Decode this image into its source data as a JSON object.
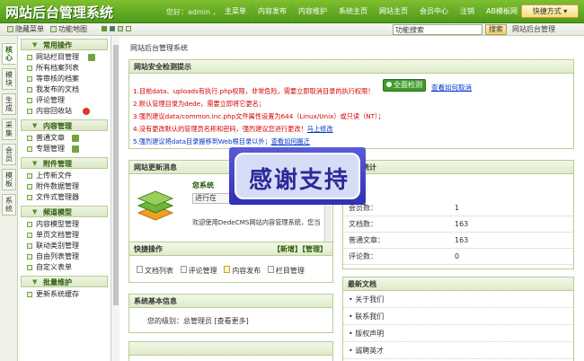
{
  "header": {
    "logo": "网站后台管理系统",
    "greeting": "您好：admin ，",
    "nav": [
      "主菜单",
      "内容发布",
      "内容维护",
      "系统主页",
      "网站主页",
      "会员中心",
      "注销",
      "AB模板网"
    ],
    "quick_button": "快捷方式 ▾"
  },
  "toolbar": {
    "hide_menu": "隐藏菜单",
    "function_map": "功能地图",
    "search_value": "功能搜索",
    "search_button": "搜索",
    "current": "网站后台管理"
  },
  "vtabs": [
    "核心",
    "模块",
    "生成",
    "采集",
    "会员",
    "模板",
    "系统"
  ],
  "sidebar": {
    "groups": [
      {
        "title": "常用操作",
        "items": [
          "网站栏目管理",
          "所有档案列表",
          "等审核的档案",
          "我发布的文档",
          "评论管理",
          "内容回收站"
        ]
      },
      {
        "title": "内容管理",
        "items": [
          "普通文章",
          "专题管理"
        ]
      },
      {
        "title": "附件管理",
        "items": [
          "上传新文件",
          "附件数据管理",
          "文件式管理器"
        ]
      },
      {
        "title": "频道模型",
        "items": [
          "内容模型管理",
          "单页文档管理",
          "联动类别管理",
          "自由列表管理",
          "自定义表单"
        ]
      },
      {
        "title": "批量维护",
        "items": [
          "更新系统缓存"
        ]
      }
    ]
  },
  "main": {
    "breadcrumb": "网站后台管理系统",
    "security": {
      "title": "网站安全检测提示",
      "lines": [
        "1.目前data、uploads有执行.php权限，非常危险，需要立即取消目录的执行权限！",
        "2.默认管理目录为dede，需要立即将它更名；",
        "3.强烈建议data/common.inc.php文件属性设置为644（Linux/Unix）或只读（NT）；",
        "4.没有更改默认的管理员名称和密码，强烈建议您进行更改！",
        "5.强烈建议将data目录搬移到Web根目录以外；"
      ],
      "line4_link": "马上修改",
      "line5_link": "查看如何搬迁",
      "detect_button": "全面检测",
      "cancel_link": "查看如何取消"
    },
    "update": {
      "title": "网站更新消息",
      "system_title": "您系统",
      "progress_label": "进行在",
      "welcome": "欢迎使用DedeCMS网站内容管理系统，您当"
    },
    "stats": {
      "title": "信息统计",
      "rows": [
        {
          "k": "会员数：",
          "v": "1"
        },
        {
          "k": "文档数：",
          "v": "163"
        },
        {
          "k": "普通文章：",
          "v": "163"
        },
        {
          "k": "评论数：",
          "v": "0"
        }
      ]
    },
    "quick": {
      "title": "快捷操作",
      "actions": "【新增】【管理】",
      "items": [
        "文档列表",
        "评论管理",
        "内容发布",
        "栏目管理"
      ]
    },
    "sysinfo": {
      "title": "系统基本信息",
      "level_label": "您的级别：",
      "level_value": "总管理员",
      "more": "[查看更多]"
    },
    "latest": {
      "title": "最新文档",
      "items": [
        "关于我们",
        "联系我们",
        "版权声明",
        "诚聘英才"
      ]
    }
  },
  "overlay": {
    "text": "感谢支持"
  }
}
